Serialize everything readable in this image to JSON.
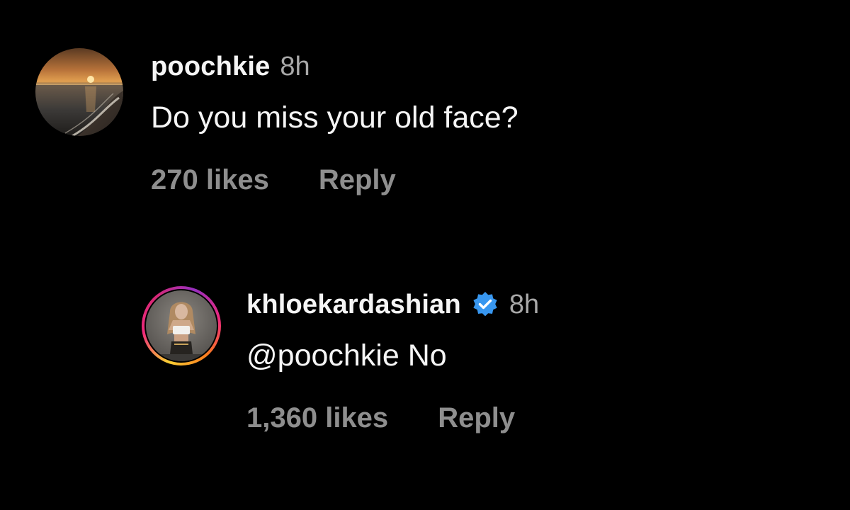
{
  "comments": [
    {
      "username": "poochkie",
      "time": "8h",
      "verified": false,
      "text": "Do you miss your old face?",
      "likes": "270 likes",
      "reply_label": "Reply",
      "avatar_icon": "sunset-beach-avatar"
    },
    {
      "username": "khloekardashian",
      "time": "8h",
      "verified": true,
      "verified_icon": "verified-badge-icon",
      "text": "@poochkie No",
      "likes": "1,360 likes",
      "reply_label": "Reply",
      "avatar_icon": "profile-photo-avatar",
      "story_ring": true
    }
  ],
  "colors": {
    "background": "#000000",
    "primary_text": "#f5f5f5",
    "secondary_text": "#a8a8a8",
    "action_text": "#8e8e8e",
    "verified_blue": "#3897f0"
  }
}
